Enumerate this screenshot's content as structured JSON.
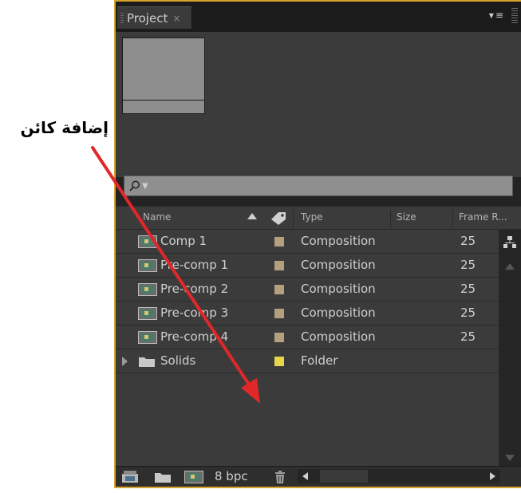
{
  "annotation": {
    "text": "إضافة كائن",
    "arrow_color": "#e0282a"
  },
  "panel": {
    "tab_label": "Project",
    "tab_close": "×",
    "menu_glyph": "≡",
    "border_color": "#d6a32c"
  },
  "columns": {
    "name": "Name",
    "type": "Type",
    "size": "Size",
    "frame_rate": "Frame R..."
  },
  "items": [
    {
      "name": "Comp 1",
      "type": "Composition",
      "frame_rate": "25",
      "label_color": "#b3a07f",
      "icon": "composition-icon"
    },
    {
      "name": "Pre-comp 1",
      "type": "Composition",
      "frame_rate": "25",
      "label_color": "#b3a07f",
      "icon": "composition-icon"
    },
    {
      "name": "Pre-comp 2",
      "type": "Composition",
      "frame_rate": "25",
      "label_color": "#b3a07f",
      "icon": "composition-icon"
    },
    {
      "name": "Pre-comp 3",
      "type": "Composition",
      "frame_rate": "25",
      "label_color": "#b3a07f",
      "icon": "composition-icon"
    },
    {
      "name": "Pre-comp 4",
      "type": "Composition",
      "frame_rate": "25",
      "label_color": "#b3a07f",
      "icon": "composition-icon"
    },
    {
      "name": "Solids",
      "type": "Folder",
      "frame_rate": "",
      "label_color": "#e8d54a",
      "icon": "folder-icon"
    }
  ],
  "footer": {
    "bpc": "8 bpc"
  }
}
